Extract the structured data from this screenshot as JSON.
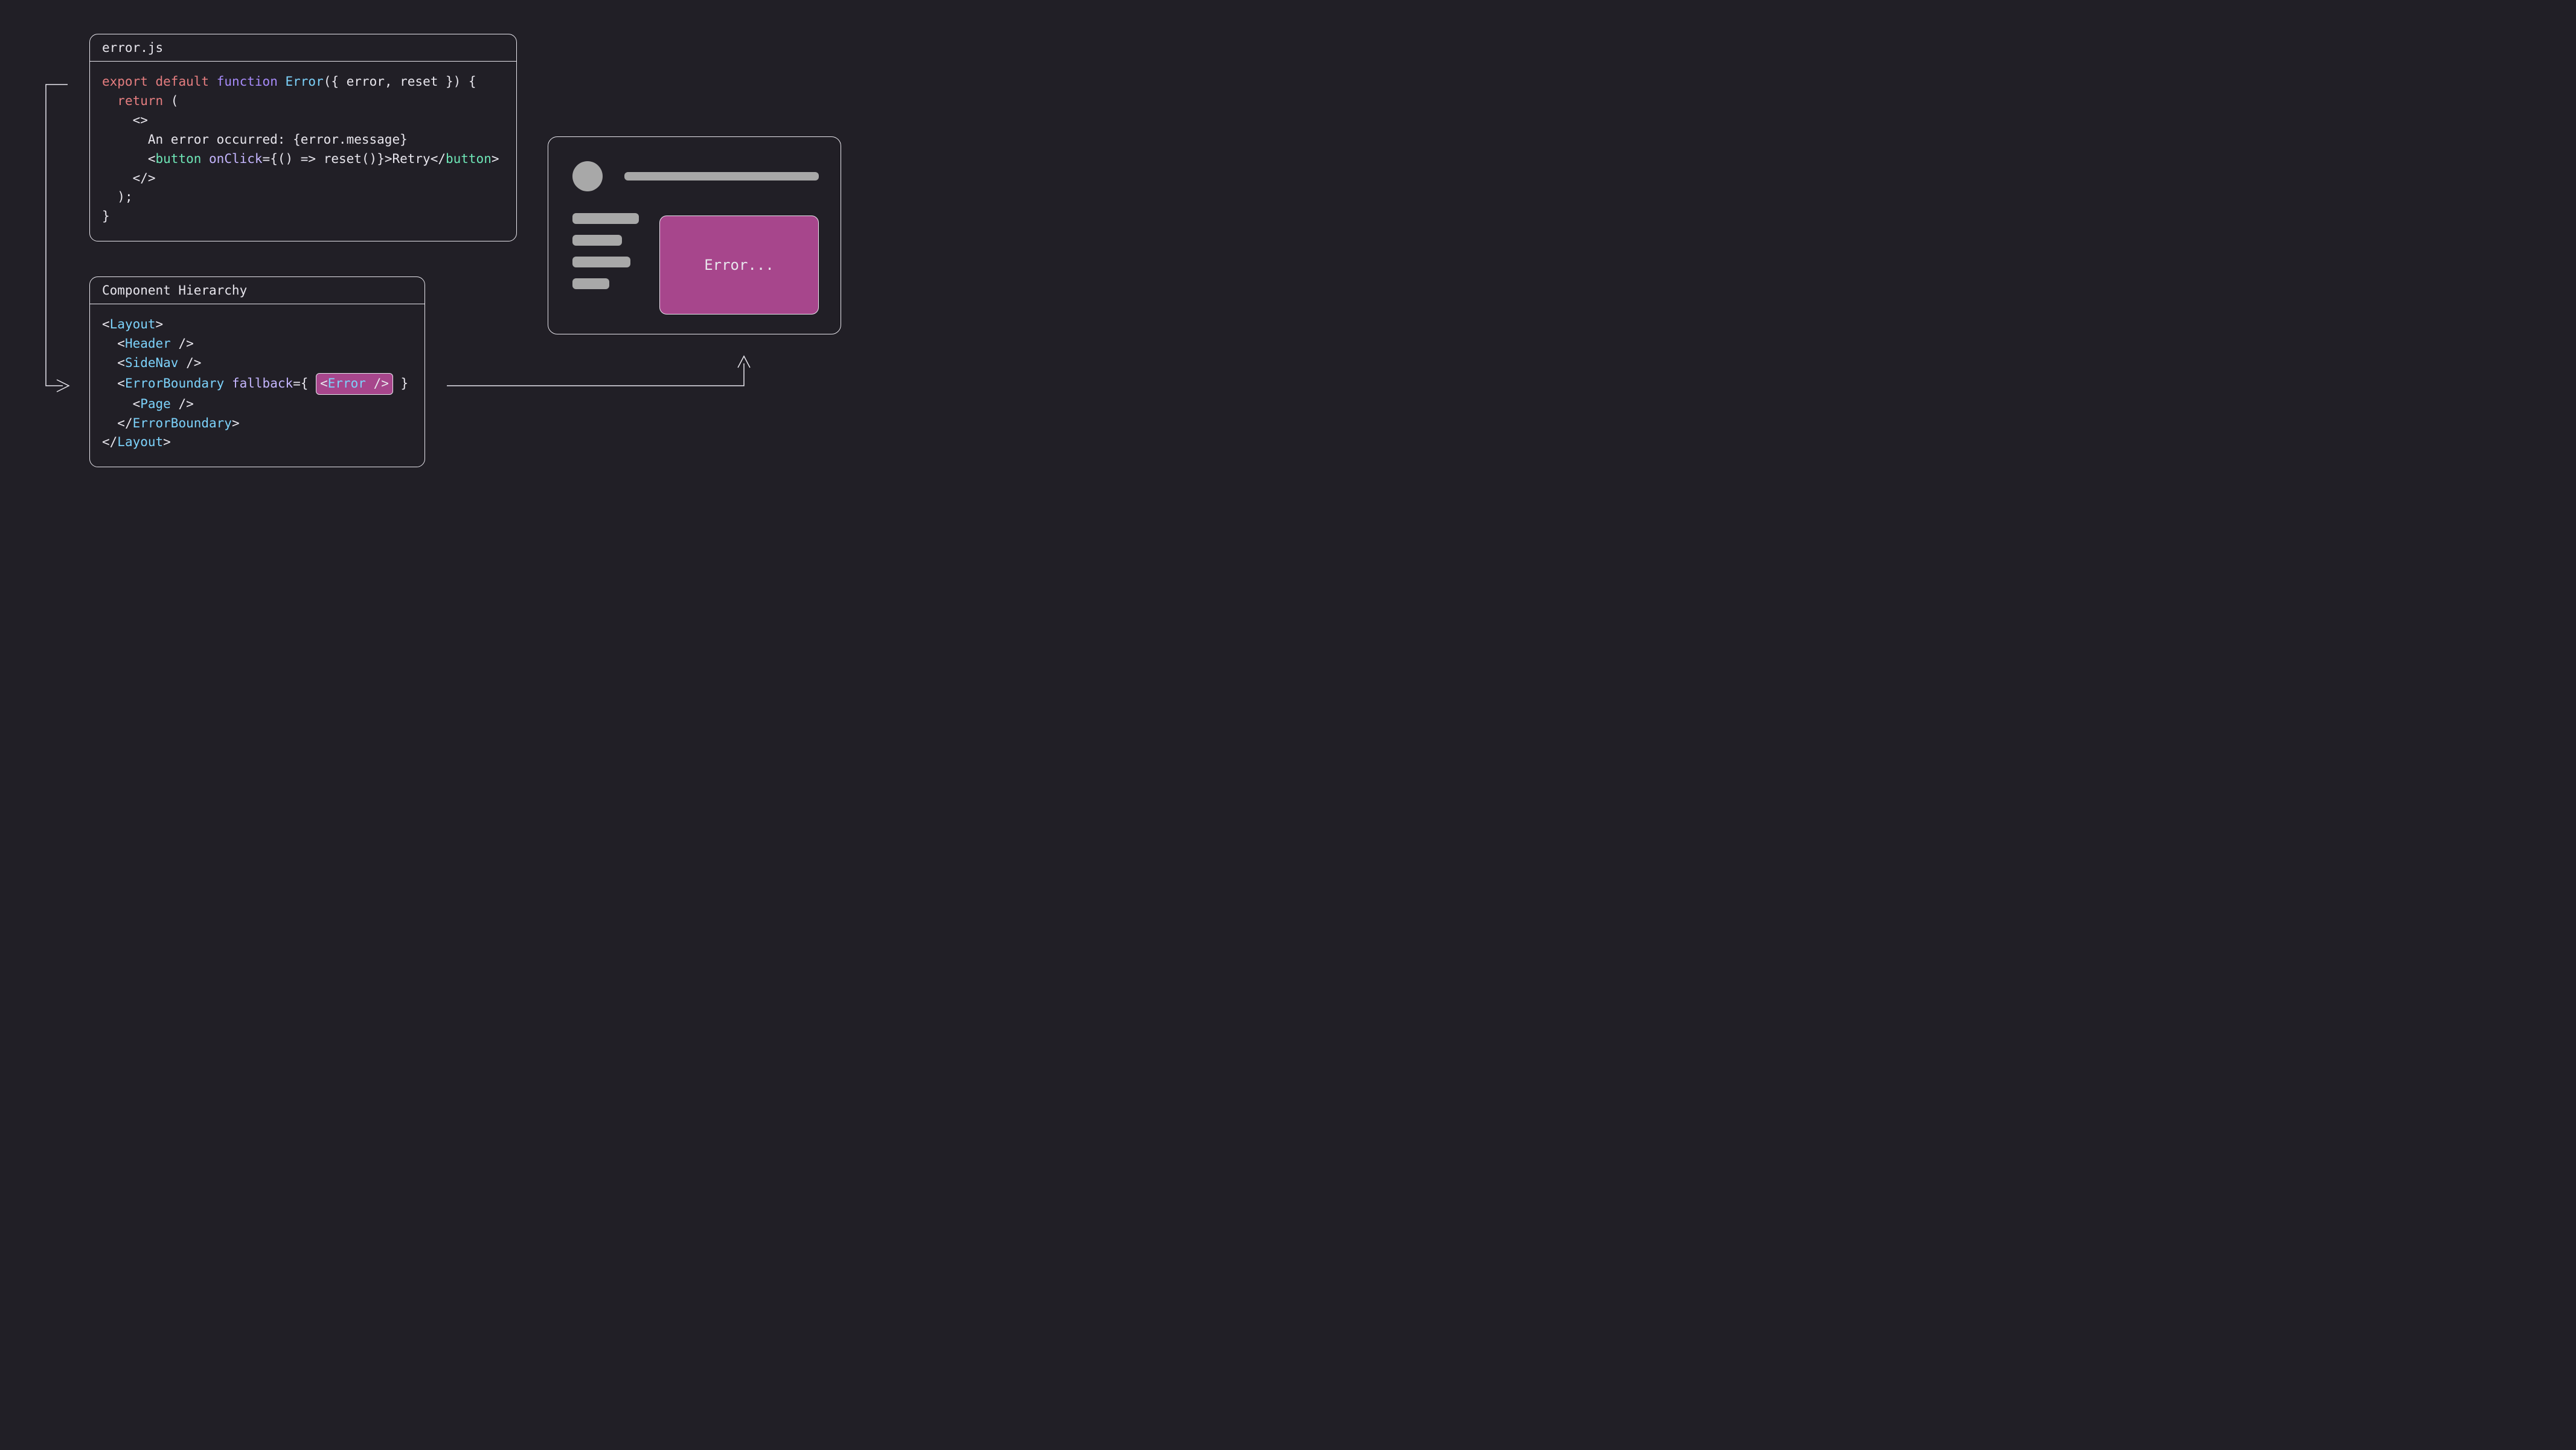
{
  "codePanel": {
    "title": "error.js",
    "tokens": {
      "export": "export",
      "default": "default",
      "function": "function",
      "fnName": "Error",
      "params": "({ error, reset }) {",
      "return": "return",
      "retOpen": " (",
      "fragOpen": "<>",
      "textLine": "An error occurred: {error.message}",
      "lt1": "<",
      "button": "button",
      "sp": " ",
      "onClick": "onClick",
      "handler": "={() => reset()}>Retry</",
      "gt1": ">",
      "fragClose": "</>",
      "retClose": ");",
      "braceClose": "}"
    }
  },
  "hierarchyPanel": {
    "title": "Component Hierarchy",
    "tokens": {
      "Layout": "Layout",
      "Header": "Header",
      "SideNav": "SideNav",
      "ErrorBoundary": "ErrorBoundary",
      "fallback": "fallback",
      "eqBrace": "={ ",
      "Error": "Error",
      "slashGt": " />",
      "closeBrace": " }",
      "Page": "Page",
      "lt": "<",
      "ltSlash": "</",
      "gt": ">",
      "selfClose": " />"
    }
  },
  "browser": {
    "errorText": "Error..."
  }
}
